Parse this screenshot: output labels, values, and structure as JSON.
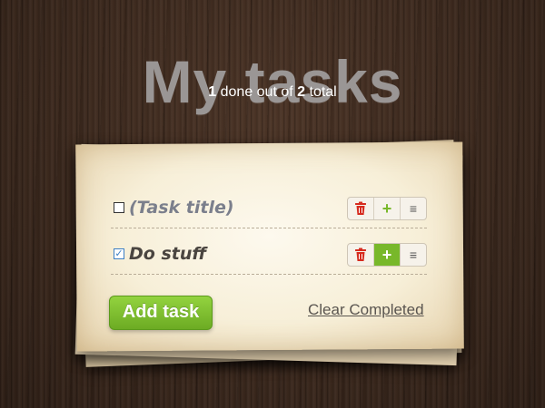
{
  "header": {
    "title": "My tasks",
    "summary": {
      "done_count": "1",
      "text_middle": " done out of ",
      "total_count": "2",
      "text_end": " total"
    }
  },
  "tasks": [
    {
      "title": "(Task title)",
      "checked": false,
      "check_mark": ""
    },
    {
      "title": "Do stuff",
      "checked": true,
      "check_mark": "✓"
    }
  ],
  "actions": {
    "delete_icon": "trash-icon",
    "add_icon": "plus-icon",
    "menu_icon": "menu-icon",
    "plus_glyph": "+",
    "menu_glyph": "≡"
  },
  "footer": {
    "add_task_label": "Add task",
    "clear_completed_label": "Clear Completed"
  },
  "colors": {
    "accent_green": "#78b82a",
    "delete_red": "#d62b1f",
    "title_gray": "#9a9695"
  }
}
